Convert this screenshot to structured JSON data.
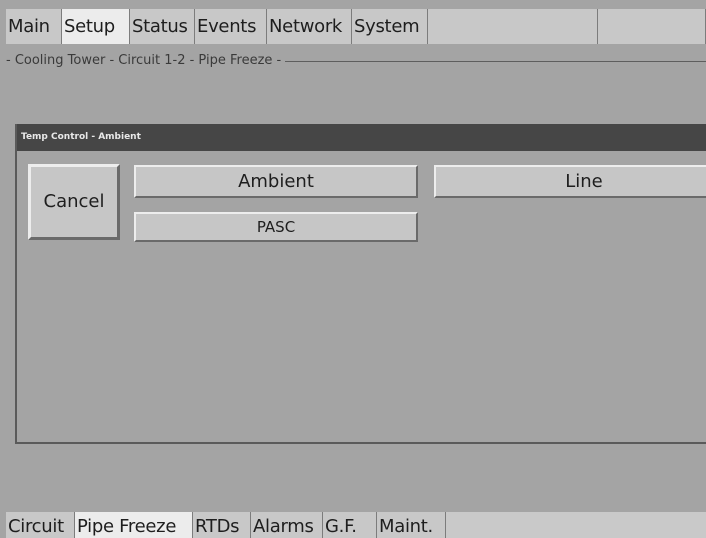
{
  "top_tabs": [
    {
      "label": "Main",
      "active": false
    },
    {
      "label": "Setup",
      "active": true
    },
    {
      "label": "Status",
      "active": false
    },
    {
      "label": "Events",
      "active": false
    },
    {
      "label": "Network",
      "active": false
    },
    {
      "label": "System",
      "active": false
    }
  ],
  "breadcrumb": "- Cooling Tower - Circuit 1-2 - Pipe Freeze -",
  "dialog": {
    "title": "Temp Control - Ambient",
    "cancel_label": "Cancel",
    "options": {
      "ambient": "Ambient",
      "line": "Line",
      "pasc": "PASC"
    }
  },
  "bottom_tabs": [
    {
      "label": "Circuit",
      "active": false
    },
    {
      "label": "Pipe Freeze",
      "active": true
    },
    {
      "label": "RTDs",
      "active": false
    },
    {
      "label": "Alarms",
      "active": false
    },
    {
      "label": "G.F.",
      "active": false
    },
    {
      "label": "Maint.",
      "active": false
    }
  ]
}
